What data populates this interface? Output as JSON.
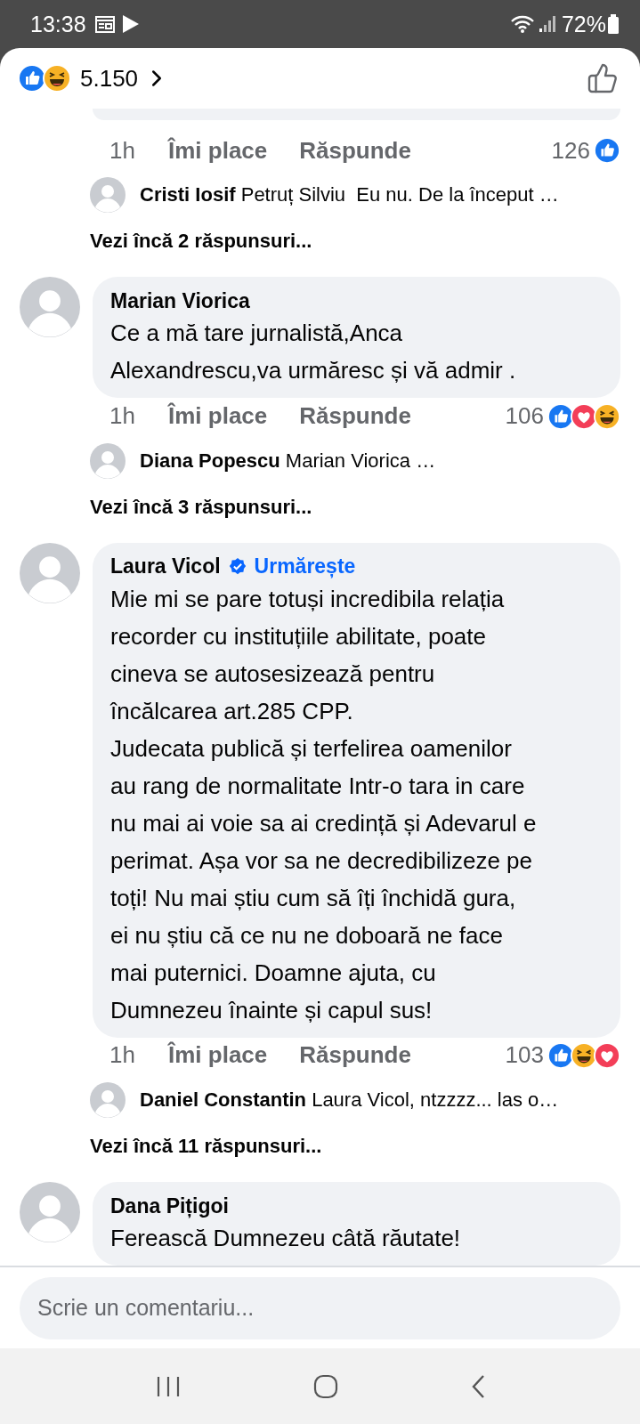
{
  "status_bar": {
    "time": "13:38",
    "battery": "72%"
  },
  "header": {
    "reactions": [
      {
        "kind": "like"
      },
      {
        "kind": "haha"
      }
    ],
    "count": "5.150"
  },
  "thread": [
    {
      "kind": "actions",
      "time": "1h",
      "like": "Îmi place",
      "reply": "Răspunde",
      "count": "126",
      "reactions": [
        {
          "kind": "like"
        }
      ]
    },
    {
      "kind": "reply",
      "author": "Cristi Iosif",
      "text": "Petruț Silviu  Eu nu. De la început …"
    },
    {
      "kind": "more",
      "text": "Vezi încă 2 răspunsuri..."
    },
    {
      "kind": "comment",
      "author": "Marian Viorica",
      "verified": false,
      "text": "Ce a mă tare jurnalistă,Anca\nAlexandrescu,va urmăresc și vă admir ."
    },
    {
      "kind": "actions",
      "time": "1h",
      "like": "Îmi place",
      "reply": "Răspunde",
      "count": "106",
      "reactions": [
        {
          "kind": "like"
        },
        {
          "kind": "love"
        },
        {
          "kind": "haha"
        }
      ]
    },
    {
      "kind": "reply",
      "author": "Diana Popescu",
      "text": "Marian Viorica …"
    },
    {
      "kind": "more",
      "text": "Vezi încă 3 răspunsuri..."
    },
    {
      "kind": "comment",
      "author": "Laura Vicol",
      "verified": true,
      "follow": "Urmărește",
      "text": "Mie mi se pare totuși incredibila relația\nrecorder cu instituțiile abilitate, poate\ncineva se autosesizează pentru\nîncălcarea art.285 CPP.\nJudecata publică și terfelirea oamenilor\nau rang de normalitate Intr-o tara in care\nnu mai ai voie sa ai credință și Adevarul e\nperimat. Așa vor sa ne decredibilizeze pe\ntoți! Nu mai știu cum să îți închidă gura,\nei nu știu că ce nu ne doboară ne face\nmai puternici. Doamne ajuta, cu\nDumnezeu înainte și capul sus!"
    },
    {
      "kind": "actions",
      "time": "1h",
      "like": "Îmi place",
      "reply": "Răspunde",
      "count": "103",
      "reactions": [
        {
          "kind": "like"
        },
        {
          "kind": "haha"
        },
        {
          "kind": "love"
        }
      ]
    },
    {
      "kind": "reply",
      "author": "Daniel Constantin",
      "text": "Laura Vicol, ntzzzz... las o…"
    },
    {
      "kind": "more",
      "text": "Vezi încă 11 răspunsuri..."
    },
    {
      "kind": "comment",
      "author": "Dana Pițigoi",
      "verified": false,
      "text": "Ferească Dumnezeu câtă răutate!"
    }
  ],
  "composer": {
    "placeholder": "Scrie un comentariu..."
  }
}
